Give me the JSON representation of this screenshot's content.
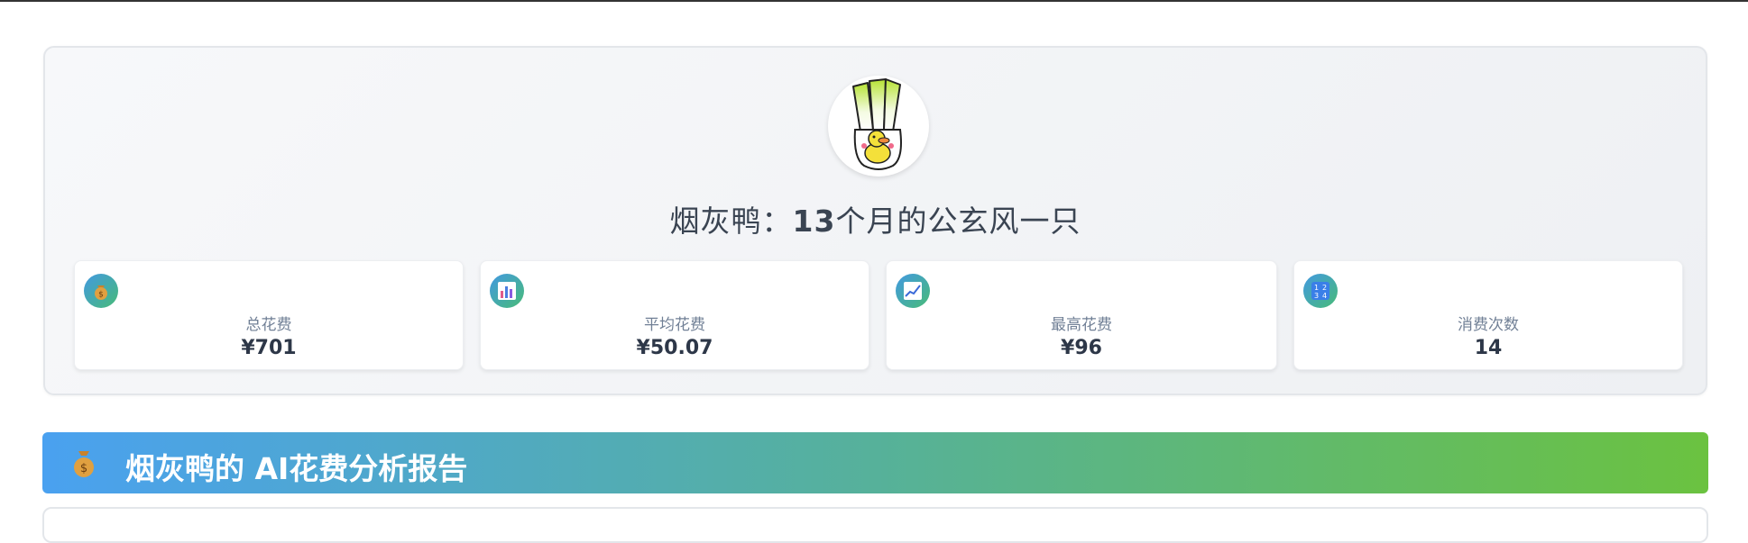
{
  "profile": {
    "name": "烟灰鸭",
    "separator": "：",
    "months": "13",
    "tagline": "个月的公玄风一只"
  },
  "stats": [
    {
      "label": "总花费",
      "value": "¥701",
      "icon": "money-bag-icon"
    },
    {
      "label": "平均花费",
      "value": "¥50.07",
      "icon": "bar-chart-icon"
    },
    {
      "label": "最高花费",
      "value": "¥96",
      "icon": "trend-chart-icon"
    },
    {
      "label": "消费次数",
      "value": "14",
      "icon": "numbers-icon"
    }
  ],
  "report": {
    "icon": "money-bag-icon",
    "title": "烟灰鸭的 AI花费分析报告"
  },
  "colors": {
    "banner_start": "#4aa1f0",
    "banner_end": "#6bc240",
    "card_border": "#e3e6ea"
  }
}
